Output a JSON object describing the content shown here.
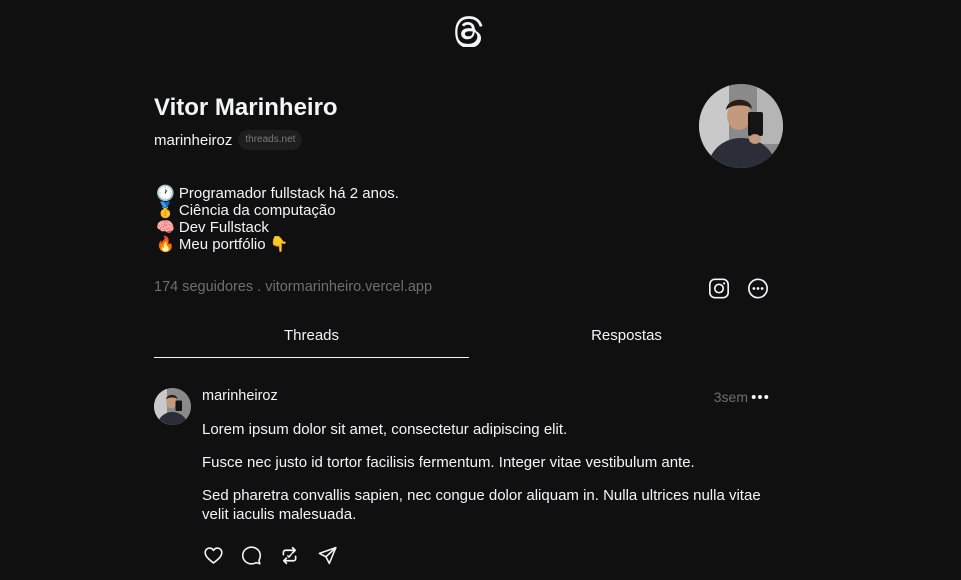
{
  "app": {
    "logo_icon": "threads-logo-icon"
  },
  "profile": {
    "name": "Vitor Marinheiro",
    "handle": "marinheiroz",
    "domain_badge": "threads.net",
    "bio": [
      {
        "emoji": "🕐",
        "text": "Programador fullstack há 2 anos."
      },
      {
        "emoji": "🥇",
        "text": "Ciência da computação"
      },
      {
        "emoji": "🧠",
        "text": "Dev Fullstack"
      },
      {
        "emoji": "🔥",
        "text": "Meu portfólio 👇"
      }
    ],
    "stats_text": "174 seguidores . vitormarinheiro.vercel.app",
    "social_icons": [
      "instagram-icon",
      "more-options-icon"
    ]
  },
  "tabs": [
    {
      "label": "Threads",
      "active": true
    },
    {
      "label": "Respostas",
      "active": false
    }
  ],
  "post": {
    "author": "marinheiroz",
    "time": "3sem",
    "paragraphs": [
      "Lorem ipsum dolor sit amet, consectetur adipiscing elit.",
      "Fusce nec justo id tortor facilisis fermentum. Integer vitae vestibulum ante.",
      "Sed pharetra convallis sapien, nec congue dolor aliquam in. Nulla ultrices nulla vitae velit iaculis malesuada."
    ],
    "actions": [
      "heart-icon",
      "comment-icon",
      "repost-icon",
      "share-icon"
    ]
  },
  "colors": {
    "background": "#101010",
    "text": "#f3f5f7",
    "muted": "#6f6f6f"
  }
}
